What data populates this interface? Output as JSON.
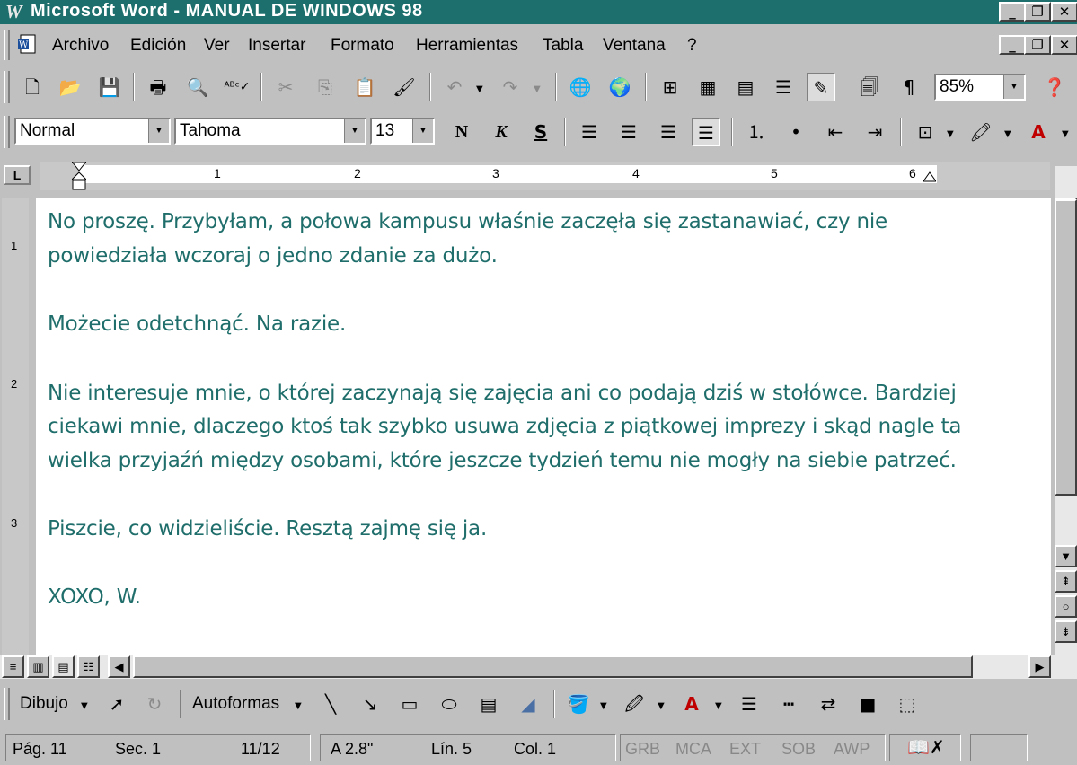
{
  "window": {
    "title": "Microsoft Word - MANUAL DE WINDOWS 98",
    "app_icon": "W"
  },
  "menu": [
    {
      "label": "Archivo"
    },
    {
      "label": "Edición"
    },
    {
      "label": "Ver"
    },
    {
      "label": "Insertar"
    },
    {
      "label": "Formato"
    },
    {
      "label": "Herramientas"
    },
    {
      "label": "Tabla"
    },
    {
      "label": "Ventana"
    },
    {
      "label": "?"
    }
  ],
  "toolbar": {
    "zoom": "85%"
  },
  "format": {
    "style": "Normal",
    "font": "Tahoma",
    "size": "13",
    "bold": "N",
    "italic": "K",
    "underline": "S"
  },
  "ruler": {
    "marks": [
      "1",
      "2",
      "3",
      "4",
      "5",
      "6"
    ]
  },
  "vruler": {
    "marks": [
      "1",
      "2",
      "3"
    ]
  },
  "document": {
    "lines": [
      "No proszę. Przybyłam, a połowa kampusu właśnie zaczęła się zastanawiać, czy nie",
      "powiedziała wczoraj o jedno zdanie za dużo.",
      "Możecie odetchnąć. Na razie.",
      "Nie interesuje mnie, o której zaczynają się zajęcia ani co podają dziś w stołówce. Bardziej",
      "ciekawi mnie, dlaczego ktoś tak szybko usuwa zdjęcia z piątkowej imprezy i skąd nagle ta",
      "wielka przyjaźń między osobami, które jeszcze tydzień temu nie mogły na siebie patrzeć.",
      "Piszcie, co widzieliście. Resztą zajmę się ja.",
      "XOXO, W."
    ],
    "text_color": "#1f6e6b"
  },
  "drawing": {
    "draw_label": "Dibujo",
    "autoshapes_label": "Autoformas"
  },
  "status": {
    "page": "Pág. 11",
    "section": "Sec. 1",
    "pages": "11/12",
    "at": "A 2.8\"",
    "line": "Lín. 5",
    "col": "Col. 1",
    "grb": "GRB",
    "mca": "MCA",
    "ext": "EXT",
    "sob": "SOB",
    "awp": "AWP"
  },
  "colors": {
    "titlebar": "#1c6f6c",
    "chrome": "#c0c0c0"
  }
}
